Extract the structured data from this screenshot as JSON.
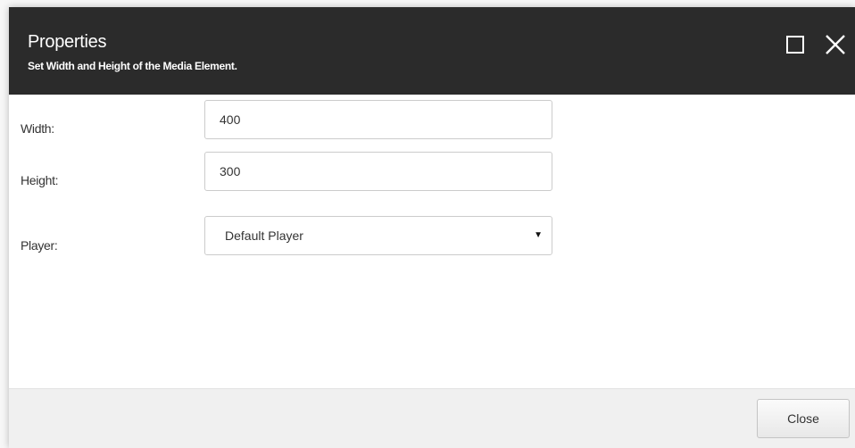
{
  "dialog": {
    "title": "Properties",
    "subtitle": "Set Width and Height of the Media Element.",
    "maximize_icon": "maximize-icon",
    "close_icon": "close-icon"
  },
  "form": {
    "width": {
      "label": "Width:",
      "value": "400"
    },
    "height": {
      "label": "Height:",
      "value": "300"
    },
    "player": {
      "label": "Player:",
      "selected": "Default Player",
      "arrow_icon": "dropdown-arrow-icon"
    }
  },
  "footer": {
    "close_label": "Close"
  },
  "colors": {
    "titlebar": "#2b2b2b",
    "footer": "#f0f0f0",
    "field_border": "#cccccc"
  }
}
